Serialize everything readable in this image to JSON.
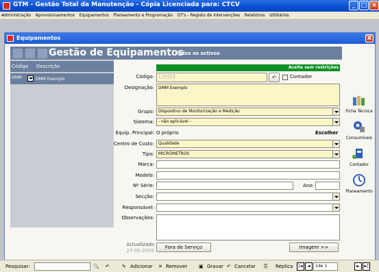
{
  "app": {
    "title": "GTM - Gestão Total da Manutenção  - Cópia Licenciada para: CTCV",
    "window_buttons": [
      "minimize",
      "maximize",
      "close"
    ]
  },
  "menu": [
    "Administração",
    "Aprovisionamentos",
    "Equipamentos",
    "Planeamento e Programação",
    "OT's - Registo de Intervenções",
    "Relatórios",
    "Utilitários"
  ],
  "child_window": {
    "title": "Equipamentos",
    "close_label": "X"
  },
  "header": {
    "title": "Gestão de Equipamentos",
    "subtitle": "Todos os activos"
  },
  "list": {
    "columns": [
      "Código",
      "Descrição"
    ],
    "rows": [
      {
        "code": "DMM",
        "description": "DMM Exemplo"
      }
    ]
  },
  "form": {
    "status_text": "Aceite sem restrições",
    "codigo": {
      "label": "Código:",
      "value": "DMM"
    },
    "contador_check": "Contador",
    "designacao": {
      "label": "Designação:",
      "value": "DMM Exemplo"
    },
    "grupo": {
      "label": "Grupo:",
      "value": "Dispositivo de Monitorização e Medição"
    },
    "sistema": {
      "label": "Sistema:",
      "value": "- não aplicável -"
    },
    "equip_principal": {
      "label": "Equip. Principal:",
      "value": "O próprio",
      "button": "Escolher"
    },
    "centro_custo": {
      "label": "Centro de Custo:",
      "value": "Qualidade"
    },
    "tipo": {
      "label": "Tipo:",
      "value": "MICRÓMETROS"
    },
    "marca": {
      "label": "Marca:",
      "value": ""
    },
    "modelo": {
      "label": "Modelo:",
      "value": ""
    },
    "n_serie": {
      "label": "Nº Série:",
      "value": ""
    },
    "ano": {
      "label": "Ano:",
      "value": ""
    },
    "seccao": {
      "label": "Secção:",
      "value": ""
    },
    "responsavel": {
      "label": "Responsável:",
      "value": ""
    },
    "observacoes": {
      "label": "Observações:",
      "value": ""
    },
    "actualizado": {
      "label": "Actualizado",
      "date": "27-05-2005"
    },
    "fora_servico": "Fora de Serviço",
    "imagem": "Imagem >>"
  },
  "side_panel": [
    {
      "label": "Ficha Técnica",
      "icon": "books-icon"
    },
    {
      "label": "Consumíveis",
      "icon": "consumables-icon"
    },
    {
      "label": "Contador",
      "icon": "counter-icon"
    },
    {
      "label": "Planeamento",
      "icon": "planning-icon"
    }
  ],
  "toolbar": {
    "search_label": "Pesquisar:",
    "search_value": "",
    "adicionar": "Adicionar",
    "remover": "Remover",
    "gravar": "Gravar",
    "cancelar": "Cancelar",
    "replica": "Réplica",
    "record": "1de 1"
  },
  "colors": {
    "titlebar": "#0a4fd0",
    "header_band": "#6b7f9e",
    "status_green": "#0d8f24",
    "field_yellow": "#fbf6c8"
  }
}
